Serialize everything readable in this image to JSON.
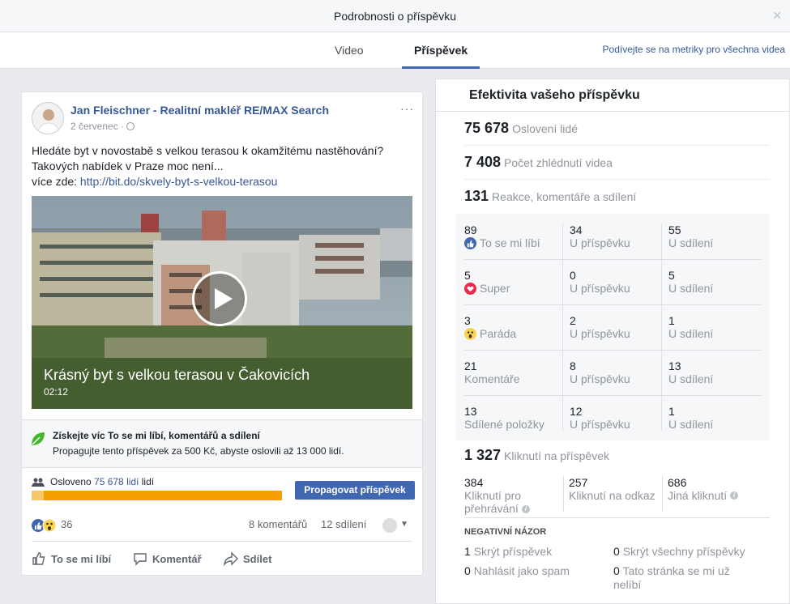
{
  "dialog": {
    "title": "Podrobnosti o příspěvku"
  },
  "tabs": [
    {
      "label": "Video"
    },
    {
      "label": "Příspěvek"
    }
  ],
  "top_link": "Podívejte se na metriky pro všechna videa",
  "post": {
    "author": "Jan Fleischner - Realitní makléř RE/MAX Search",
    "date": "2 červenec",
    "date_sep": "·",
    "more": "···",
    "text_line1": "Hledáte byt v novostabě s velkou terasou k okamžitému nastěhování?",
    "text_line2": "Takových nabídek v Praze moc není...",
    "text_line3_prefix": "více zde: ",
    "link": "http://bit.do/skvely-byt-s-velkou-terasou",
    "video_title": "Krásný byt s velkou terasou v Čakovicích",
    "video_duration": "02:12",
    "boost_title": "Získejte víc To se mi líbí, komentářů a sdílení",
    "boost_desc": "Propagujte tento příspěvek za 500 Kč, abyste oslovili až 13 000 lidí.",
    "reach_prefix": "Osloveno ",
    "reach_link": "75 678 lidí",
    "reach_suffix": " lidí",
    "reach_fill": 0.05,
    "promote_button": "Propagovat příspěvek",
    "reaction_count": "36",
    "comments": "8 komentářů",
    "shares": "12 sdílení",
    "actions": {
      "like": "To se mi líbí",
      "comment": "Komentář",
      "share": "Sdílet"
    }
  },
  "panel": {
    "title": "Efektivita vašeho příspěvku",
    "reach": {
      "value": "75 678",
      "label": "Oslovení lidé"
    },
    "views": {
      "value": "7 408",
      "label": "Počet zhlédnutí videa"
    },
    "engagement": {
      "value": "131",
      "label": "Reakce, komentáře a sdílení"
    },
    "rows": [
      {
        "total": "89",
        "label": "To se mi líbí",
        "icon": "like-icon",
        "on_post": "34",
        "on_post_label": "U příspěvku",
        "on_share": "55",
        "on_share_label": "U sdílení"
      },
      {
        "total": "5",
        "label": "Super",
        "icon": "love-icon",
        "on_post": "0",
        "on_post_label": "U příspěvku",
        "on_share": "5",
        "on_share_label": "U sdílení"
      },
      {
        "total": "3",
        "label": "Paráda",
        "icon": "wow-icon",
        "on_post": "2",
        "on_post_label": "U příspěvku",
        "on_share": "1",
        "on_share_label": "U sdílení"
      },
      {
        "total": "21",
        "label": "Komentáře",
        "icon": "",
        "on_post": "8",
        "on_post_label": "U příspěvku",
        "on_share": "13",
        "on_share_label": "U sdílení"
      },
      {
        "total": "13",
        "label": "Sdílené položky",
        "icon": "",
        "on_post": "12",
        "on_post_label": "U příspěvku",
        "on_share": "1",
        "on_share_label": "U sdílení"
      }
    ],
    "clicks": {
      "value": "1 327",
      "label": "Kliknutí na příspěvek"
    },
    "click_rows": [
      {
        "value": "384",
        "label": "Kliknutí pro přehrávání"
      },
      {
        "value": "257",
        "label": "Kliknutí na odkaz"
      },
      {
        "value": "686",
        "label": "Jiná kliknutí"
      }
    ],
    "negative_title": "NEGATIVNÍ NÁZOR",
    "negative": [
      {
        "value": "1",
        "label": "Skrýt příspěvek"
      },
      {
        "value": "0",
        "label": "Skrýt všechny příspěvky"
      },
      {
        "value": "0",
        "label": "Nahlásit jako spam"
      },
      {
        "value": "0",
        "label": "Tato stránka se mi už nelíbí"
      }
    ]
  },
  "colors": {
    "accent": "#4267b2",
    "link": "#365899",
    "reach_bar": "#f59f00"
  }
}
